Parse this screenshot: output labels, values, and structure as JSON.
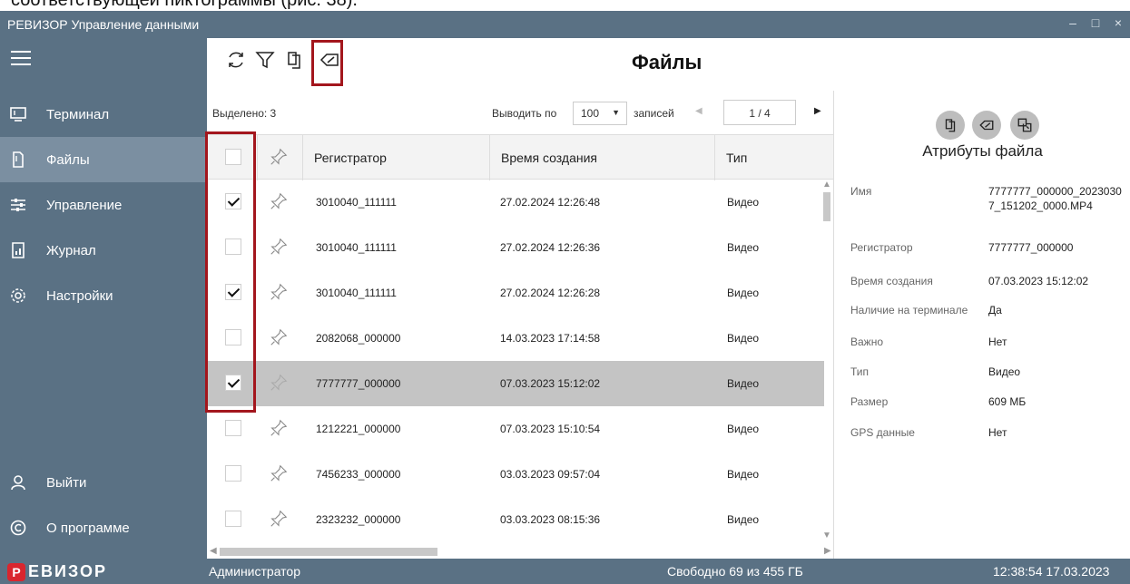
{
  "caption": "соответствующей пиктограммы (рис. 38).",
  "window": {
    "title": "РЕВИЗОР Управление данными"
  },
  "sidebar": {
    "items": [
      {
        "label": "Терминал"
      },
      {
        "label": "Файлы"
      },
      {
        "label": "Управление"
      },
      {
        "label": "Журнал"
      },
      {
        "label": "Настройки"
      }
    ],
    "logout": "Выйти",
    "about": "О программе"
  },
  "header": {
    "title": "Файлы"
  },
  "pager": {
    "selected": "Выделено: 3",
    "show_per": "Выводить по",
    "per_page": "100",
    "records": "записей",
    "page": "1 / 4"
  },
  "table": {
    "columns": [
      "Регистратор",
      "Время создания",
      "Тип"
    ],
    "rows": [
      {
        "registrar": "3010040_111111",
        "created": "27.02.2024 12:26:48",
        "type": "Видео",
        "checked": true
      },
      {
        "registrar": "3010040_111111",
        "created": "27.02.2024 12:26:36",
        "type": "Видео",
        "checked": false
      },
      {
        "registrar": "3010040_111111",
        "created": "27.02.2024 12:26:28",
        "type": "Видео",
        "checked": true
      },
      {
        "registrar": "2082068_000000",
        "created": "14.03.2023 17:14:58",
        "type": "Видео",
        "checked": false
      },
      {
        "registrar": "7777777_000000",
        "created": "07.03.2023 15:12:02",
        "type": "Видео",
        "checked": true
      },
      {
        "registrar": "1212221_000000",
        "created": "07.03.2023 15:10:54",
        "type": "Видео",
        "checked": false
      },
      {
        "registrar": "7456233_000000",
        "created": "03.03.2023 09:57:04",
        "type": "Видео",
        "checked": false
      },
      {
        "registrar": "2323232_000000",
        "created": "03.03.2023 08:15:36",
        "type": "Видео",
        "checked": false
      }
    ]
  },
  "attributes": {
    "title": "Атрибуты файла",
    "name_label": "Имя",
    "name_value": "7777777_000000_20230307_151202_0000.MP4",
    "registrar_label": "Регистратор",
    "registrar_value": "7777777_000000",
    "created_label": "Время создания",
    "created_value": "07.03.2023 15:12:02",
    "terminal_label": "Наличие на терминале",
    "terminal_value": "Да",
    "important_label": "Важно",
    "important_value": "Нет",
    "type_label": "Тип",
    "type_value": "Видео",
    "size_label": "Размер",
    "size_value": "609 МБ",
    "gps_label": "GPS данные",
    "gps_value": "Нет"
  },
  "status": {
    "logo_letter": "Р",
    "logo_text": "ЕВИЗОР",
    "user": "Администратор",
    "free": "Свободно 69 из 455 ГБ",
    "datetime": "12:38:54 17.03.2023"
  },
  "colors": {
    "chrome": "#5a7184",
    "active_nav": "#7b8fa1",
    "highlight": "#a3161d",
    "selected_row": "#c4c4c4",
    "logo": "#d9262e"
  }
}
